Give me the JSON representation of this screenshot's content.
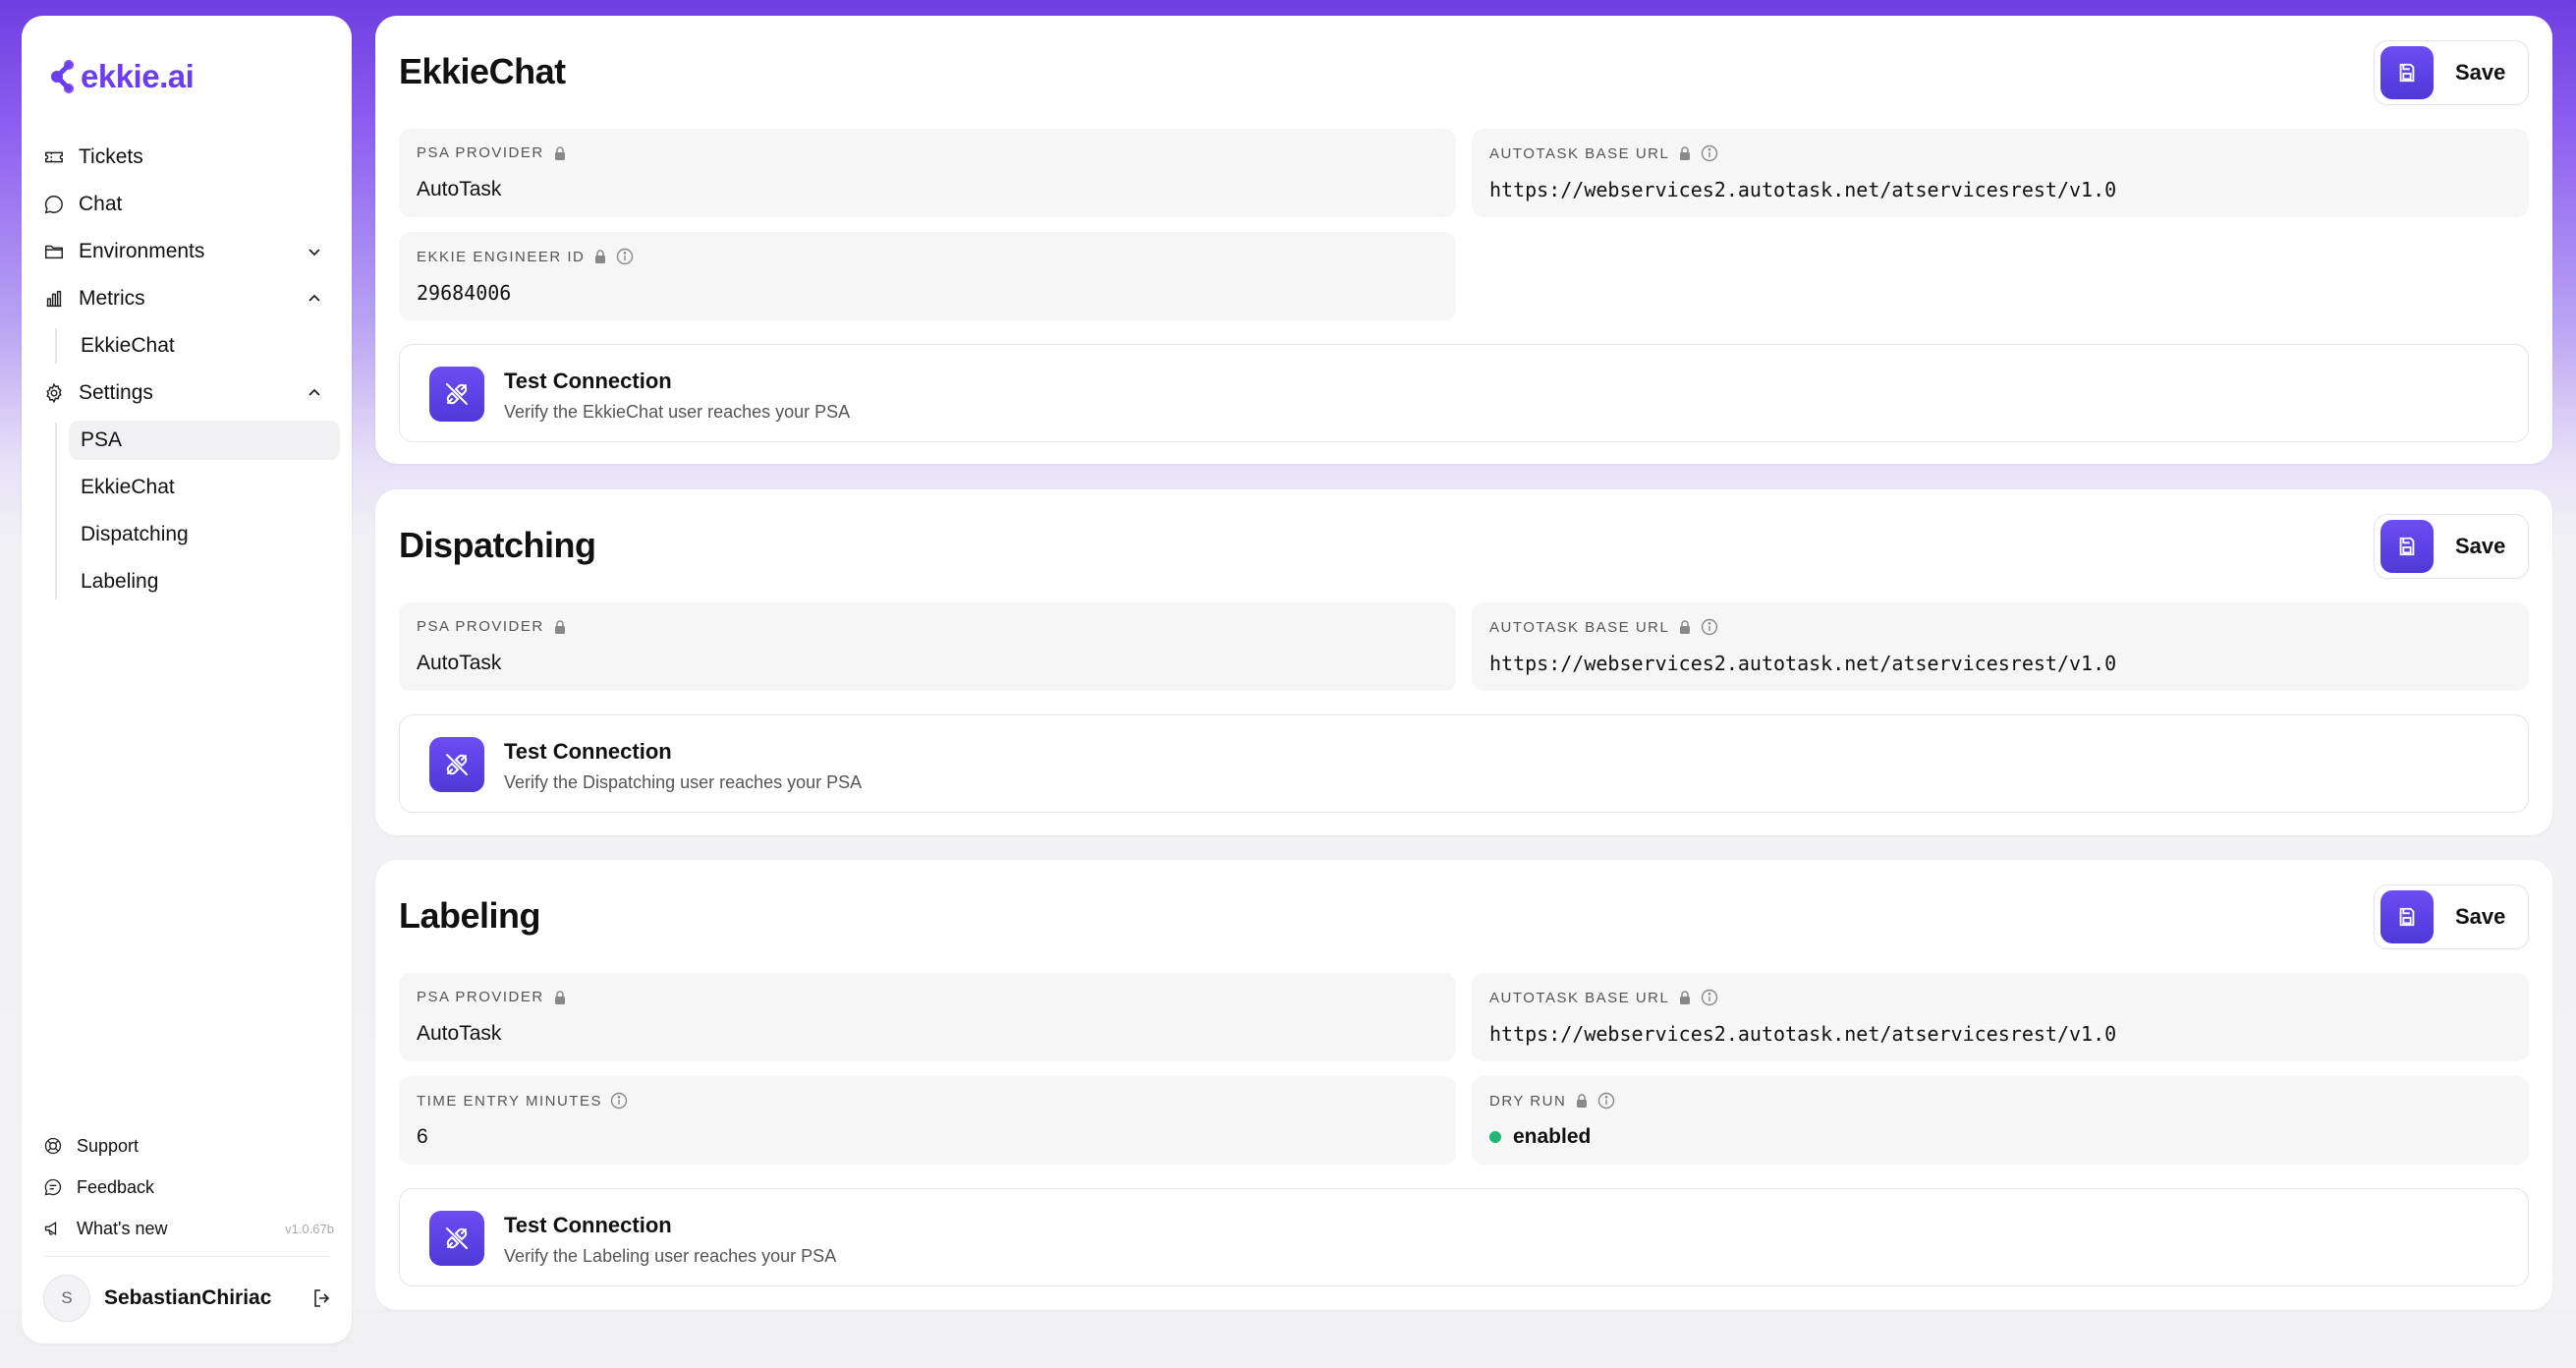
{
  "app": {
    "logo_text": "ekkie.ai",
    "version": "v1.0.67b"
  },
  "colors": {
    "accent": "#5b3fe6",
    "status_enabled": "#22b573"
  },
  "sidebar": {
    "nav": [
      {
        "label": "Tickets",
        "icon": "ticket-icon"
      },
      {
        "label": "Chat",
        "icon": "chat-bubble-icon"
      },
      {
        "label": "Environments",
        "icon": "folder-icon"
      },
      {
        "label": "Metrics",
        "icon": "bar-chart-icon"
      },
      {
        "label": "EkkieChat"
      },
      {
        "label": "Settings",
        "icon": "gear-icon"
      },
      {
        "label": "PSA"
      },
      {
        "label": "EkkieChat"
      },
      {
        "label": "Dispatching"
      },
      {
        "label": "Labeling"
      }
    ],
    "footer": [
      {
        "label": "Support",
        "icon": "lifebuoy-icon"
      },
      {
        "label": "Feedback",
        "icon": "message-icon"
      },
      {
        "label": "What's new",
        "icon": "megaphone-icon"
      }
    ],
    "user": {
      "initial": "S",
      "name": "SebastianChiriac"
    }
  },
  "sections": [
    {
      "title": "EkkieChat",
      "save_label": "Save",
      "fields": [
        {
          "label": "PSA PROVIDER",
          "value": "AutoTask"
        },
        {
          "label": "AUTOTASK BASE URL",
          "value": "https://webservices2.autotask.net/atservicesrest/v1.0"
        },
        {
          "label": "EKKIE ENGINEER ID",
          "value": "29684006"
        }
      ],
      "test": {
        "title": "Test Connection",
        "subtitle": "Verify the EkkieChat user reaches your PSA"
      }
    },
    {
      "title": "Dispatching",
      "save_label": "Save",
      "fields": [
        {
          "label": "PSA PROVIDER",
          "value": "AutoTask"
        },
        {
          "label": "AUTOTASK BASE URL",
          "value": "https://webservices2.autotask.net/atservicesrest/v1.0"
        }
      ],
      "test": {
        "title": "Test Connection",
        "subtitle": "Verify the Dispatching user reaches your PSA"
      }
    },
    {
      "title": "Labeling",
      "save_label": "Save",
      "fields": [
        {
          "label": "PSA PROVIDER",
          "value": "AutoTask"
        },
        {
          "label": "AUTOTASK BASE URL",
          "value": "https://webservices2.autotask.net/atservicesrest/v1.0"
        },
        {
          "label": "TIME ENTRY MINUTES",
          "value": "6"
        },
        {
          "label": "DRY RUN",
          "value": "enabled"
        }
      ],
      "test": {
        "title": "Test Connection",
        "subtitle": "Verify the Labeling user reaches your PSA"
      }
    }
  ]
}
